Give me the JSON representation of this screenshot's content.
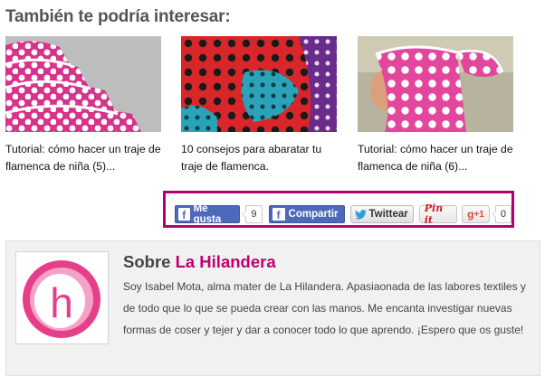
{
  "heading": "También te podría interesar:",
  "related": [
    {
      "caption": "Tutorial: cómo hacer un traje de flamenca de niña (5)..."
    },
    {
      "caption": "10 consejos para abaratar tu traje de flamenca."
    },
    {
      "caption": "Tutorial: cómo hacer un traje de flamenca de niña (6)..."
    }
  ],
  "share": {
    "facebook_like": {
      "label": "Me gusta",
      "count": "9"
    },
    "facebook_share": {
      "label": "Compartir"
    },
    "twitter": {
      "label": "Twittear"
    },
    "pinterest": {
      "label": "Pin it"
    },
    "google_plus": {
      "label": "+1",
      "count": "0"
    }
  },
  "about": {
    "title_prefix": "Sobre",
    "title_name": "La Hilandera",
    "logo_letter": "h",
    "text": "Soy Isabel Mota, alma mater de La Hilandera. Apasiaonada de las labores textiles y de todo que lo que se pueda crear con las manos. Me encanta investigar nuevas formas de coser y tejer y dar a conocer todo lo que aprendo. ¡Espero que os guste!"
  },
  "colors": {
    "accent": "#b4006e",
    "facebook": "#4c69ba",
    "heading": "#555555",
    "about_bg": "#f1f1f1"
  }
}
